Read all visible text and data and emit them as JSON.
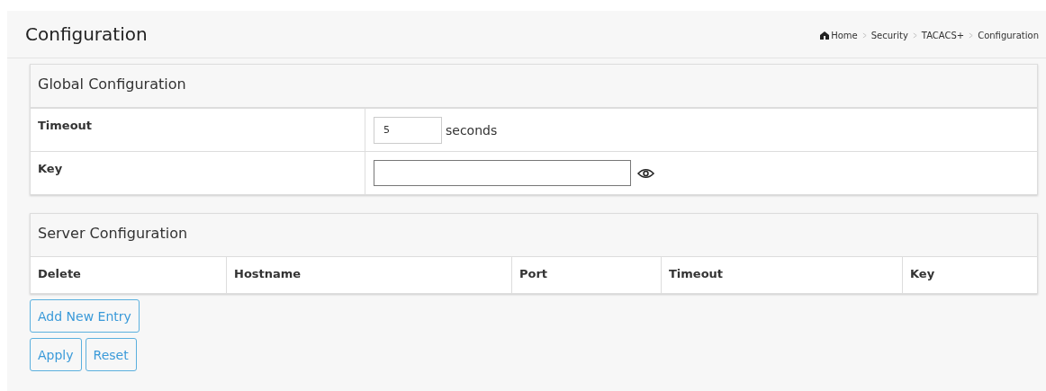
{
  "page": {
    "title": "Configuration"
  },
  "breadcrumb": [
    "Home",
    "Security",
    "TACACS+",
    "Configuration"
  ],
  "global_configuration": {
    "title": "Global Configuration",
    "rows": [
      {
        "label": "Timeout",
        "kind": "number",
        "value": "5",
        "unit": "seconds"
      },
      {
        "label": "Key",
        "kind": "password",
        "value": ""
      }
    ]
  },
  "server_configuration": {
    "title": "Server Configuration",
    "columns": [
      "Delete",
      "Hostname",
      "Port",
      "Timeout",
      "Key"
    ]
  },
  "button_groups": [
    [
      "Add New Entry"
    ],
    [
      "Apply",
      "Reset"
    ]
  ]
}
